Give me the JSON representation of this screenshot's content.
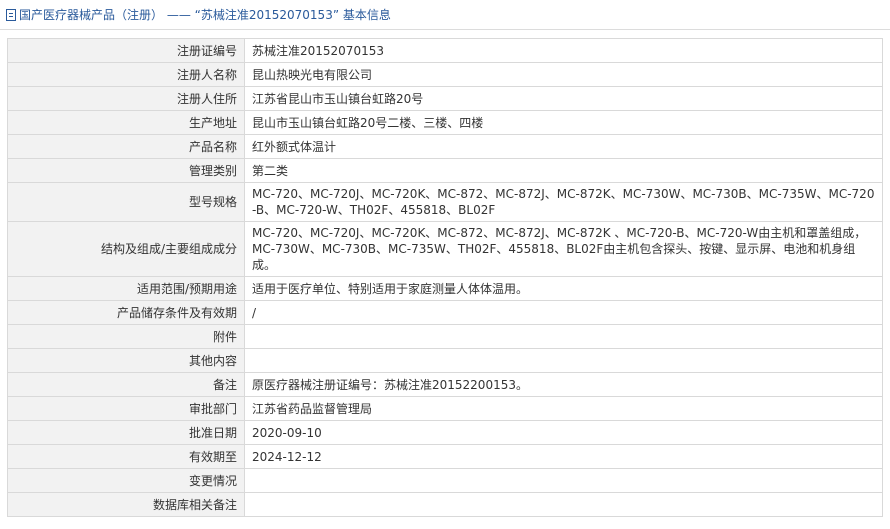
{
  "header": {
    "icon": "document-icon",
    "title": "国产医疗器械产品（注册） —— “苏械注准20152070153” 基本信息"
  },
  "rows": [
    {
      "label": "注册证编号",
      "value": "苏械注准20152070153"
    },
    {
      "label": "注册人名称",
      "value": "昆山热映光电有限公司"
    },
    {
      "label": "注册人住所",
      "value": "江苏省昆山市玉山镇台虹路20号"
    },
    {
      "label": "生产地址",
      "value": "昆山市玉山镇台虹路20号二楼、三楼、四楼"
    },
    {
      "label": "产品名称",
      "value": "红外额式体温计"
    },
    {
      "label": "管理类别",
      "value": "第二类"
    },
    {
      "label": "型号规格",
      "value": "MC-720、MC-720J、MC-720K、MC-872、MC-872J、MC-872K、MC-730W、MC-730B、MC-735W、MC-720-B、MC-720-W、TH02F、455818、BL02F"
    },
    {
      "label": "结构及组成/主要组成成分",
      "value": "MC-720、MC-720J、MC-720K、MC-872、MC-872J、MC-872K 、MC-720-B、MC-720-W由主机和罩盖组成，MC-730W、MC-730B、MC-735W、TH02F、455818、BL02F由主机包含探头、按键、显示屏、电池和机身组成。"
    },
    {
      "label": "适用范围/预期用途",
      "value": "适用于医疗单位、特别适用于家庭测量人体体温用。"
    },
    {
      "label": "产品储存条件及有效期",
      "value": "/"
    },
    {
      "label": "附件",
      "value": ""
    },
    {
      "label": "其他内容",
      "value": ""
    },
    {
      "label": "备注",
      "value": "原医疗器械注册证编号：苏械注准20152200153。"
    },
    {
      "label": "审批部门",
      "value": "江苏省药品监督管理局"
    },
    {
      "label": "批准日期",
      "value": "2020-09-10"
    },
    {
      "label": "有效期至",
      "value": "2024-12-12"
    },
    {
      "label": "变更情况",
      "value": ""
    },
    {
      "label": "数据库相关备注",
      "value": ""
    }
  ]
}
